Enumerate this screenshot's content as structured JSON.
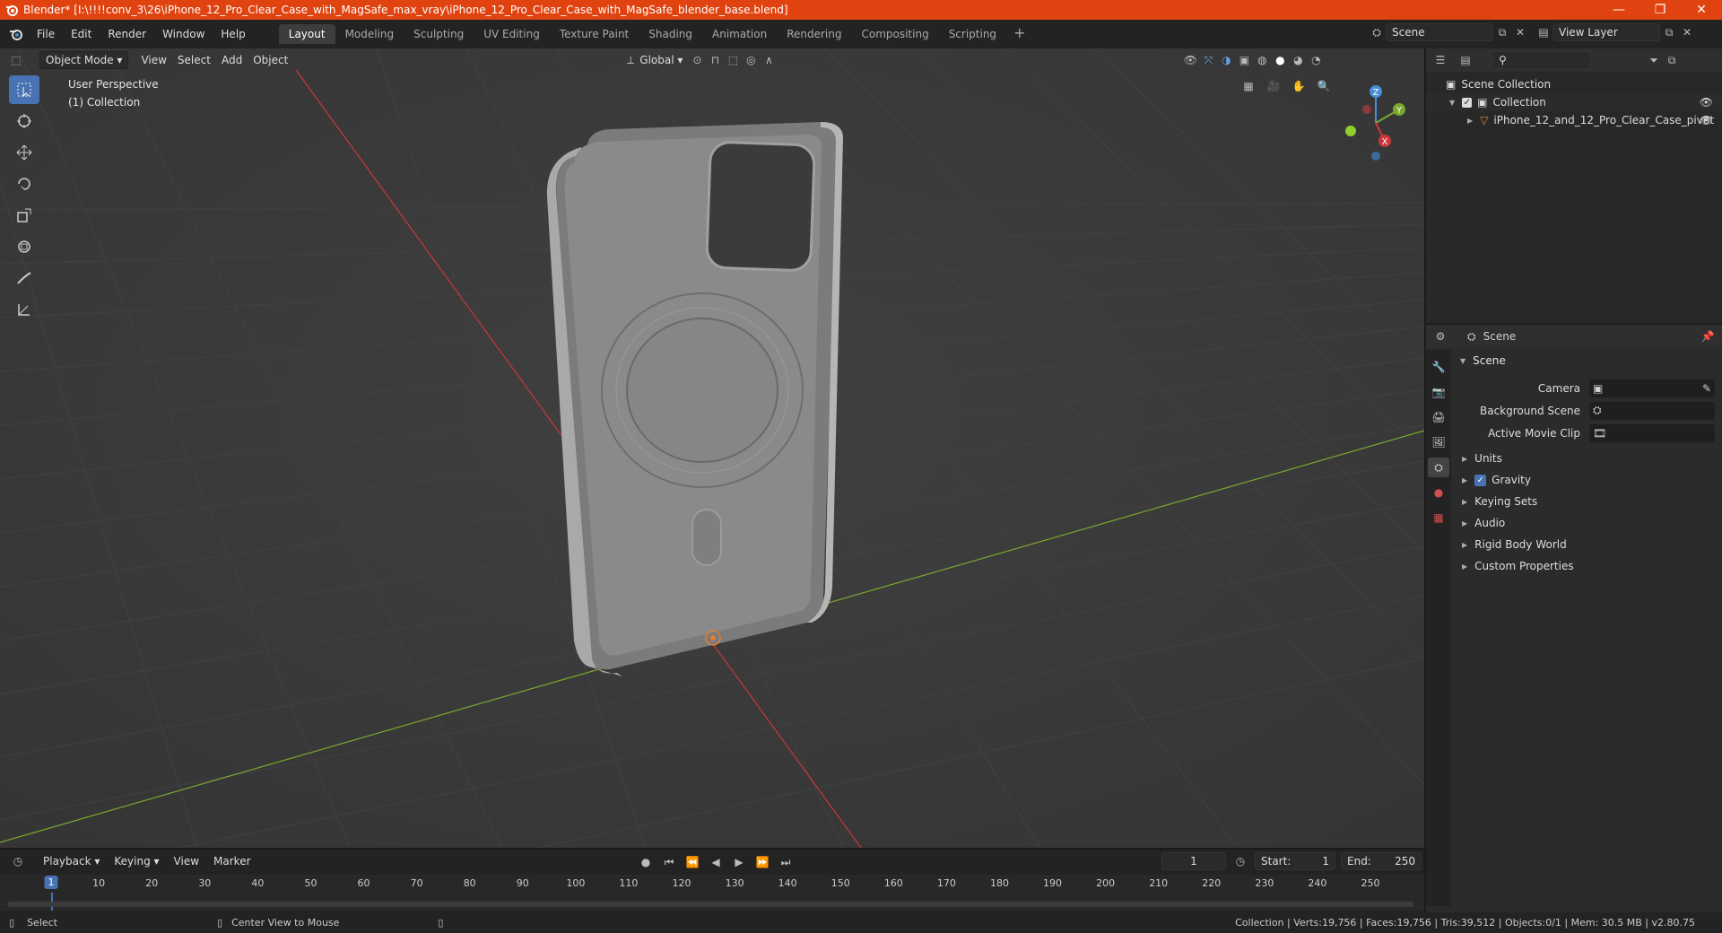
{
  "window": {
    "title": "Blender* [I:\\!!!!conv_3\\26\\iPhone_12_Pro_Clear_Case_with_MagSafe_max_vray\\iPhone_12_Pro_Clear_Case_with_MagSafe_blender_base.blend]",
    "minimize": "—",
    "maximize": "❐",
    "close": "✕"
  },
  "menu": [
    "File",
    "Edit",
    "Render",
    "Window",
    "Help"
  ],
  "workspaces": [
    "Layout",
    "Modeling",
    "Sculpting",
    "UV Editing",
    "Texture Paint",
    "Shading",
    "Animation",
    "Rendering",
    "Compositing",
    "Scripting"
  ],
  "active_workspace": "Layout",
  "scene_selector": "Scene",
  "view_layer": "View Layer",
  "viewport": {
    "mode": "Object Mode",
    "menus": [
      "View",
      "Select",
      "Add",
      "Object"
    ],
    "transform_orientation": "Global",
    "info_line1": "User Perspective",
    "info_line2": "(1) Collection"
  },
  "gizmo_axes": [
    "Z",
    "Y",
    "X"
  ],
  "outliner": {
    "root": "Scene Collection",
    "collection": "Collection",
    "object": "iPhone_12_and_12_Pro_Clear_Case_pivot"
  },
  "properties": {
    "header": "Scene",
    "panel": "Scene",
    "fields": [
      {
        "label": "Camera"
      },
      {
        "label": "Background Scene"
      },
      {
        "label": "Active Movie Clip"
      }
    ],
    "subpanels": [
      "Units",
      "Gravity",
      "Keying Sets",
      "Audio",
      "Rigid Body World",
      "Custom Properties"
    ]
  },
  "timeline": {
    "menus": [
      "Playback",
      "Keying",
      "View",
      "Marker"
    ],
    "current_frame": "1",
    "start_label": "Start:",
    "start": "1",
    "end_label": "End:",
    "end": "250",
    "ticks": [
      "10",
      "20",
      "30",
      "40",
      "50",
      "60",
      "70",
      "80",
      "90",
      "100",
      "110",
      "120",
      "130",
      "140",
      "150",
      "160",
      "170",
      "180",
      "190",
      "200",
      "210",
      "220",
      "230",
      "240",
      "250"
    ],
    "cursor_label": "1"
  },
  "statusbar": {
    "left": "Select",
    "middle": "Center View to Mouse",
    "stats": "Collection | Verts:19,756 | Faces:19,756 | Tris:39,512 | Objects:0/1 | Mem: 30.5 MB | v2.80.75"
  },
  "colors": {
    "titlebar": "#e0430f",
    "accent": "#4772b3",
    "x_axis": "#c9373a",
    "y_axis": "#7aa82e"
  }
}
